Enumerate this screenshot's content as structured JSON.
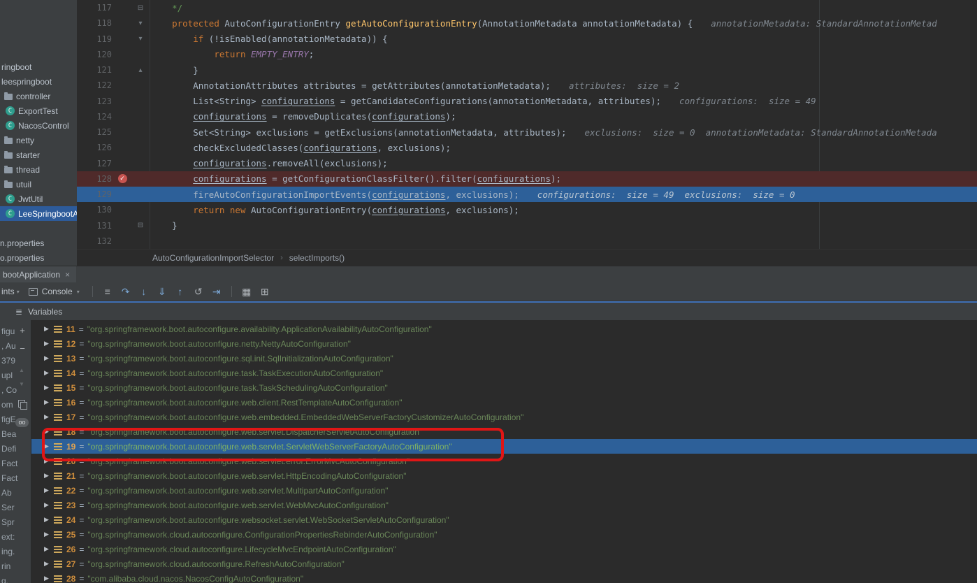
{
  "colors": {
    "annotation_red": "#e01616",
    "execution_line_blue": "#2d6099",
    "breakpoint_line_red": "#4f2a2a",
    "project_selection_blue": "#2d5b9a"
  },
  "project_panel": {
    "items": [
      {
        "label": "ringboot",
        "icon": "none",
        "pad": 2
      },
      {
        "label": "leespringboot",
        "icon": "none",
        "pad": 2
      },
      {
        "label": "controller",
        "icon": "folder",
        "pad": 6
      },
      {
        "label": "ExportTest",
        "icon": "class",
        "pad": 8
      },
      {
        "label": "NacosControl",
        "icon": "class",
        "pad": 8
      },
      {
        "label": "netty",
        "icon": "folder",
        "pad": 6
      },
      {
        "label": "starter",
        "icon": "folder",
        "pad": 6
      },
      {
        "label": "thread",
        "icon": "folder",
        "pad": 6
      },
      {
        "label": "utuil",
        "icon": "folder",
        "pad": 6
      },
      {
        "label": "JwtUtil",
        "icon": "class",
        "pad": 8
      },
      {
        "label": "LeeSpringbootAp",
        "icon": "class",
        "pad": 8,
        "selected": true
      },
      {
        "label": "",
        "icon": "none",
        "pad": 0,
        "spacer": true
      },
      {
        "label": "n.properties",
        "icon": "none",
        "pad": 0
      },
      {
        "label": "o.properties",
        "icon": "none",
        "pad": 0
      }
    ]
  },
  "editor": {
    "fold_glyphs": {
      "sq": "⊟",
      "dn": "▾",
      "up": "▴"
    },
    "breakpoint_glyph": "✓",
    "breadcrumb": {
      "class_name": "AutoConfigurationImportSelector",
      "separator": "›",
      "method_name": "selectImports()"
    },
    "lines": [
      {
        "n": "117",
        "fold": "sq",
        "tokens": [
          [
            "    */",
            "cm"
          ]
        ]
      },
      {
        "n": "118",
        "fold": "dn",
        "tokens": [
          [
            "    ",
            ""
          ],
          [
            "protected ",
            "kw"
          ],
          [
            "AutoConfigurationEntry ",
            ""
          ],
          [
            "getAutoConfigurationEntry",
            "fn"
          ],
          [
            "(AnnotationMetadata annotationMetadata) {",
            ""
          ]
        ],
        "hint": "annotationMetadata: StandardAnnotationMetad"
      },
      {
        "n": "119",
        "fold": "dn",
        "tokens": [
          [
            "        ",
            ""
          ],
          [
            "if ",
            "kw"
          ],
          [
            "(!isEnabled(annotationMetadata)) {",
            ""
          ]
        ]
      },
      {
        "n": "120",
        "tokens": [
          [
            "            ",
            ""
          ],
          [
            "return ",
            "kw"
          ],
          [
            "EMPTY_ENTRY",
            "cn"
          ],
          [
            ";",
            ""
          ]
        ]
      },
      {
        "n": "121",
        "fold": "up",
        "tokens": [
          [
            "        }",
            ""
          ]
        ]
      },
      {
        "n": "122",
        "tokens": [
          [
            "        AnnotationAttributes attributes = getAttributes(annotationMetadata);",
            ""
          ]
        ],
        "hint": "attributes:  size = 2"
      },
      {
        "n": "123",
        "tokens": [
          [
            "        List<String> ",
            ""
          ],
          [
            "configurations",
            "u"
          ],
          [
            " = getCandidateConfigurations(annotationMetadata, attributes);",
            ""
          ]
        ],
        "hint": "configurations:  size = 49"
      },
      {
        "n": "124",
        "tokens": [
          [
            "        ",
            ""
          ],
          [
            "configurations",
            "u"
          ],
          [
            " = removeDuplicates(",
            ""
          ],
          [
            "configurations",
            "u"
          ],
          [
            ");",
            ""
          ]
        ]
      },
      {
        "n": "125",
        "tokens": [
          [
            "        Set<String> exclusions = getExclusions(annotationMetadata, attributes);",
            ""
          ]
        ],
        "hint": "exclusions:  size = 0  annotationMetadata: StandardAnnotationMetada"
      },
      {
        "n": "126",
        "tokens": [
          [
            "        checkExcludedClasses(",
            ""
          ],
          [
            "configurations",
            "u"
          ],
          [
            ", exclusions);",
            ""
          ]
        ]
      },
      {
        "n": "127",
        "tokens": [
          [
            "        ",
            ""
          ],
          [
            "configurations",
            "u"
          ],
          [
            ".removeAll(exclusions);",
            ""
          ]
        ]
      },
      {
        "n": "128",
        "state": "bp",
        "tokens": [
          [
            "        ",
            ""
          ],
          [
            "configurations",
            "u"
          ],
          [
            " = getConfigurationClassFilter().filter(",
            ""
          ],
          [
            "configurations",
            "u"
          ],
          [
            ");",
            ""
          ]
        ]
      },
      {
        "n": "129",
        "state": "cur",
        "tokens": [
          [
            "        fireAutoConfigurationImportEvents(",
            ""
          ],
          [
            "configurations",
            "u"
          ],
          [
            ", exclusions);",
            ""
          ]
        ],
        "hint": "configurations:  size = 49  exclusions:  size = 0"
      },
      {
        "n": "130",
        "tokens": [
          [
            "        ",
            ""
          ],
          [
            "return ",
            "kw"
          ],
          [
            "new ",
            "kw"
          ],
          [
            "AutoConfigurationEntry(",
            ""
          ],
          [
            "configurations",
            "u"
          ],
          [
            ", exclusions);",
            ""
          ]
        ]
      },
      {
        "n": "131",
        "fold": "sq",
        "tokens": [
          [
            "    }",
            ""
          ]
        ]
      },
      {
        "n": "132",
        "tokens": []
      }
    ]
  },
  "debug": {
    "session_tab": {
      "label": "bootApplication",
      "close_glyph": "×"
    },
    "toolbar": {
      "left_fragment": "ints",
      "console_tab_label": "Console",
      "icons": [
        {
          "name": "mute-breakpoints-icon",
          "glyph": "≡",
          "tone": "gray"
        },
        {
          "name": "step-over-icon",
          "glyph": "↷",
          "tone": "blue"
        },
        {
          "name": "step-into-icon",
          "glyph": "↓",
          "tone": "blue"
        },
        {
          "name": "force-step-into-icon",
          "glyph": "⇓",
          "tone": "blue"
        },
        {
          "name": "step-out-icon",
          "glyph": "↑",
          "tone": "blue"
        },
        {
          "name": "drop-frame-icon",
          "glyph": "↺",
          "tone": "gray"
        },
        {
          "name": "run-to-cursor-icon",
          "glyph": "⇥",
          "tone": "blue"
        },
        {
          "name": "sep"
        },
        {
          "name": "coverage-table-icon",
          "glyph": "▦",
          "tone": "gray"
        },
        {
          "name": "layout-settings-icon",
          "glyph": "⊞",
          "tone": "gray"
        }
      ]
    },
    "variables_header": {
      "icon_glyph": "≣",
      "label": "Variables"
    },
    "left_strip": {
      "fragments": [
        "figu",
        ", Au",
        "379",
        "upl",
        ", Co",
        "om",
        "figE",
        "Bea",
        "Defi",
        "Fact",
        "Fact",
        "Ab",
        "Ser",
        "Spr",
        "ext:",
        "ing.",
        "rin",
        "g."
      ],
      "plus": "+",
      "minus": "−",
      "scroll_up": "▲",
      "scroll_down": "▼",
      "oo_badge": "oo"
    },
    "variables": [
      {
        "index": "11",
        "value": "\"org.springframework.boot.autoconfigure.availability.ApplicationAvailabilityAutoConfiguration\""
      },
      {
        "index": "12",
        "value": "\"org.springframework.boot.autoconfigure.netty.NettyAutoConfiguration\""
      },
      {
        "index": "13",
        "value": "\"org.springframework.boot.autoconfigure.sql.init.SqlInitializationAutoConfiguration\""
      },
      {
        "index": "14",
        "value": "\"org.springframework.boot.autoconfigure.task.TaskExecutionAutoConfiguration\""
      },
      {
        "index": "15",
        "value": "\"org.springframework.boot.autoconfigure.task.TaskSchedulingAutoConfiguration\""
      },
      {
        "index": "16",
        "value": "\"org.springframework.boot.autoconfigure.web.client.RestTemplateAutoConfiguration\""
      },
      {
        "index": "17",
        "value": "\"org.springframework.boot.autoconfigure.web.embedded.EmbeddedWebServerFactoryCustomizerAutoConfiguration\""
      },
      {
        "index": "18",
        "value": "\"org.springframework.boot.autoconfigure.web.servlet.DispatcherServletAutoConfiguration\""
      },
      {
        "index": "19",
        "value": "\"org.springframework.boot.autoconfigure.web.servlet.ServletWebServerFactoryAutoConfiguration\"",
        "selected": true
      },
      {
        "index": "20",
        "value": "\"org.springframework.boot.autoconfigure.web.servlet.error.ErrorMvcAutoConfiguration\""
      },
      {
        "index": "21",
        "value": "\"org.springframework.boot.autoconfigure.web.servlet.HttpEncodingAutoConfiguration\""
      },
      {
        "index": "22",
        "value": "\"org.springframework.boot.autoconfigure.web.servlet.MultipartAutoConfiguration\""
      },
      {
        "index": "23",
        "value": "\"org.springframework.boot.autoconfigure.web.servlet.WebMvcAutoConfiguration\""
      },
      {
        "index": "24",
        "value": "\"org.springframework.boot.autoconfigure.websocket.servlet.WebSocketServletAutoConfiguration\""
      },
      {
        "index": "25",
        "value": "\"org.springframework.cloud.autoconfigure.ConfigurationPropertiesRebinderAutoConfiguration\""
      },
      {
        "index": "26",
        "value": "\"org.springframework.cloud.autoconfigure.LifecycleMvcEndpointAutoConfiguration\""
      },
      {
        "index": "27",
        "value": "\"org.springframework.cloud.autoconfigure.RefreshAutoConfiguration\""
      },
      {
        "index": "28",
        "value": "\"com.alibaba.cloud.nacos.NacosConfigAutoConfiguration\""
      }
    ]
  },
  "annotation": {
    "color": "#e01616"
  }
}
